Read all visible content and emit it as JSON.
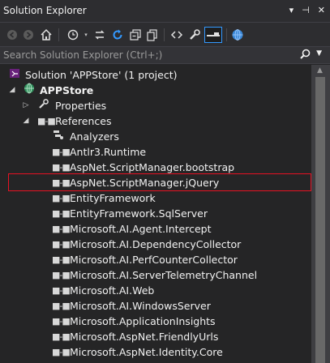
{
  "window": {
    "title": "Solution Explorer",
    "controls": [
      "▾",
      "⊣",
      "✕"
    ]
  },
  "toolbar": {
    "items": [
      "back-icon",
      "forward-icon",
      "home-icon",
      "history-icon",
      "sync-icon",
      "refresh-icon",
      "collapse-all-icon",
      "show-all-files-icon",
      "view-code-icon",
      "properties-icon",
      "preview-icon",
      "globe-icon"
    ]
  },
  "search": {
    "placeholder": "Search Solution Explorer (Ctrl+;)",
    "value": ""
  },
  "tree": {
    "solution": {
      "label": "Solution 'APPStore' (1 project)"
    },
    "project": {
      "label": "APPStore"
    },
    "properties": {
      "label": "Properties"
    },
    "references": {
      "label": "References"
    },
    "items": [
      "Analyzers",
      "Antlr3.Runtime",
      "AspNet.ScriptManager.bootstrap",
      "AspNet.ScriptManager.jQuery",
      "EntityFramework",
      "EntityFramework.SqlServer",
      "Microsoft.AI.Agent.Intercept",
      "Microsoft.AI.DependencyCollector",
      "Microsoft.AI.PerfCounterCollector",
      "Microsoft.AI.ServerTelemetryChannel",
      "Microsoft.AI.Web",
      "Microsoft.AI.WindowsServer",
      "Microsoft.ApplicationInsights",
      "Microsoft.AspNet.FriendlyUrls",
      "Microsoft.AspNet.Identity.Core"
    ]
  },
  "colors": {
    "background": "#252526",
    "highlight_box": "#e81123",
    "accent": "#3399ff"
  }
}
